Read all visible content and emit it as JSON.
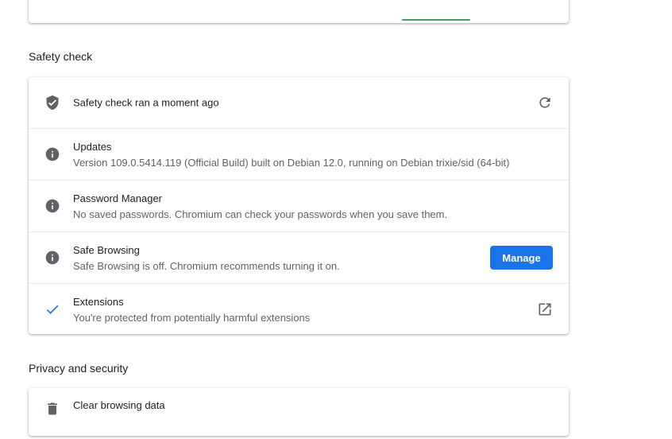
{
  "safety_check": {
    "title": "Safety check",
    "header": {
      "text": "Safety check ran a moment ago",
      "icon": "shield-check-icon",
      "action_icon": "refresh-icon"
    },
    "items": [
      {
        "title": "Updates",
        "description": "Version 109.0.5414.119 (Official Build) built on Debian 12.0, running on Debian trixie/sid (64-bit)",
        "icon": "info-icon"
      },
      {
        "title": "Password Manager",
        "description": "No saved passwords. Chromium can check your passwords when you save them.",
        "icon": "info-icon"
      },
      {
        "title": "Safe Browsing",
        "description": "Safe Browsing is off. Chromium recommends turning it on.",
        "icon": "info-icon",
        "button_label": "Manage"
      },
      {
        "title": "Extensions",
        "description": "You're protected from potentially harmful extensions",
        "icon": "checkmark-icon",
        "action_icon": "open-in-new-icon"
      }
    ]
  },
  "privacy": {
    "title": "Privacy and security",
    "items": [
      {
        "title": "Clear browsing data",
        "icon": "trash-icon"
      }
    ]
  },
  "colors": {
    "accent": "#1a73e8",
    "icon_grey": "#5f6368",
    "success_green": "#1e8e3e"
  }
}
